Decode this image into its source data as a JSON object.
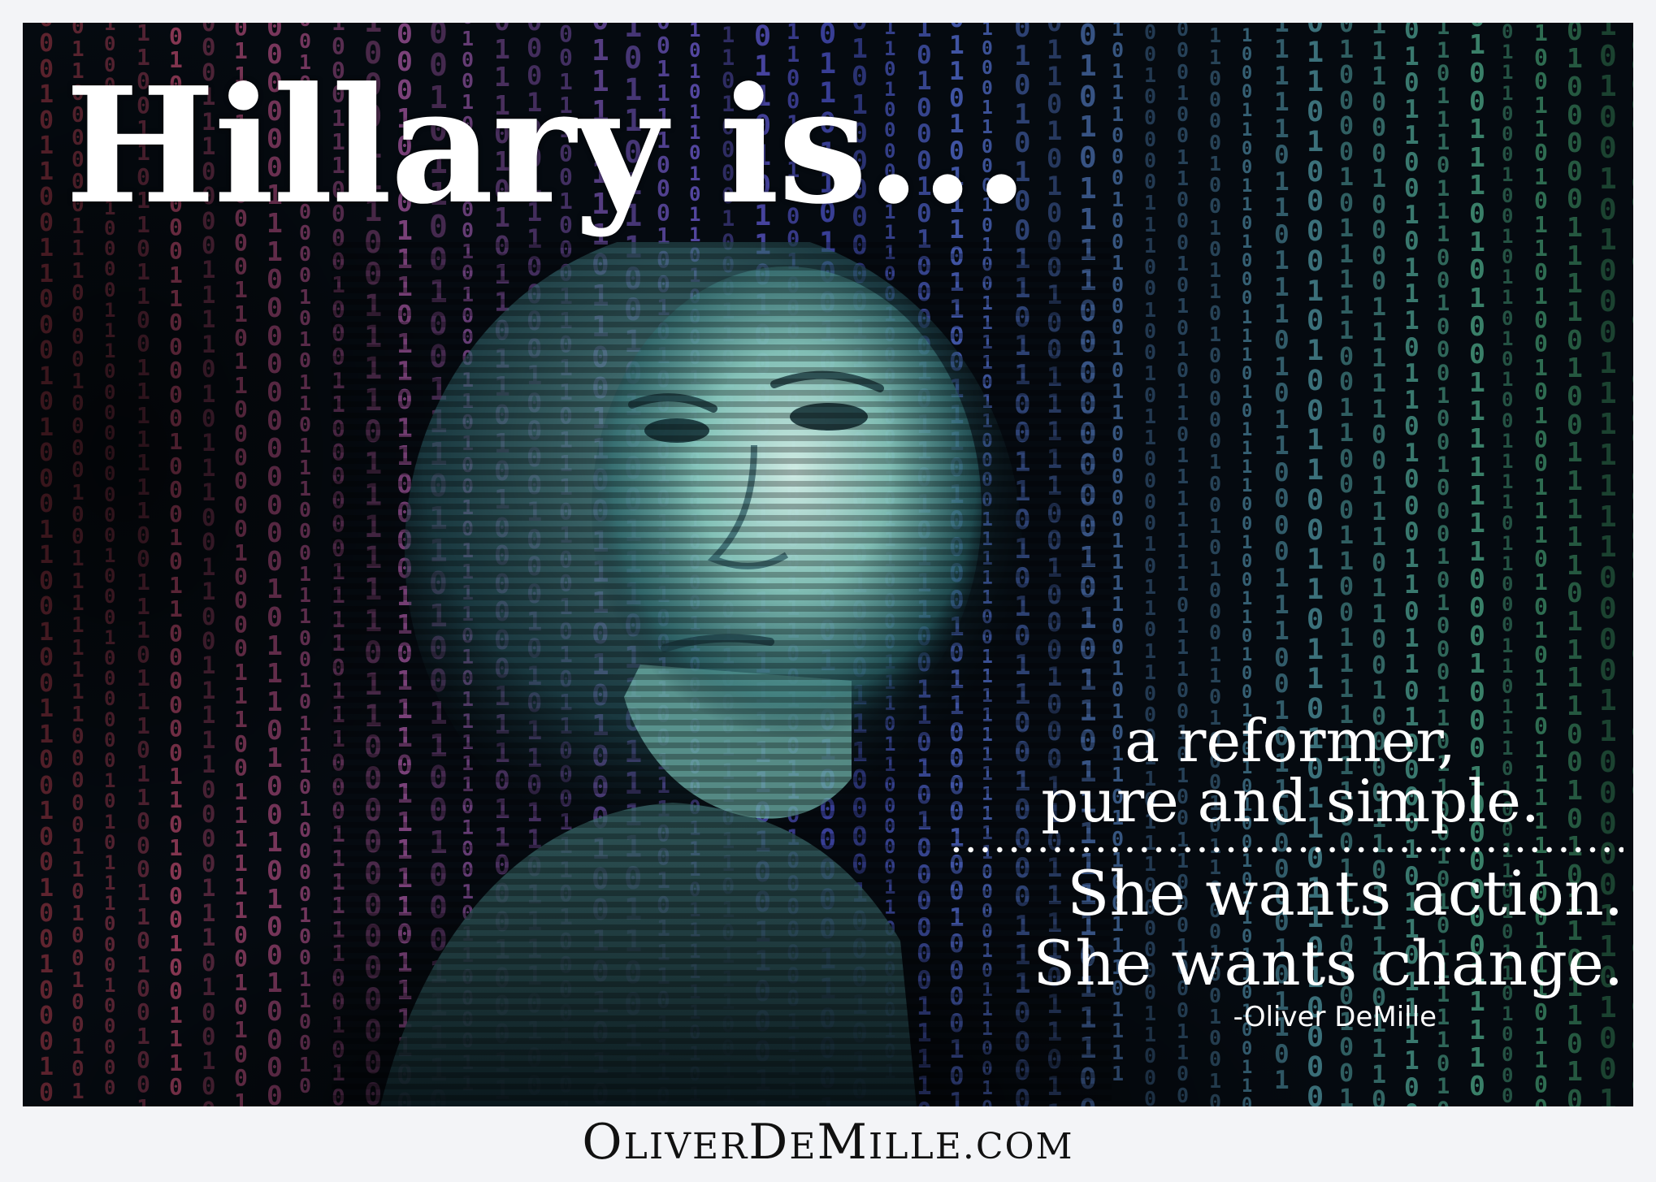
{
  "poster": {
    "headline": "Hillary is...",
    "quote_line1": "a reformer,",
    "quote_line2": "pure and simple.",
    "quote_line3": "She wants action.",
    "quote_line4": "She wants change.",
    "attribution": "-Oliver DeMille"
  },
  "footer": {
    "site_url": "OliverDeMille.com"
  },
  "colors": {
    "background": "#050a10",
    "headline": "#ffffff",
    "binary_left": "#c0404e",
    "binary_center": "#4a52c8",
    "binary_right": "#3fa060",
    "portrait_tint": "#8fd0c4"
  },
  "decoration": {
    "binary_digits": "0 1"
  }
}
